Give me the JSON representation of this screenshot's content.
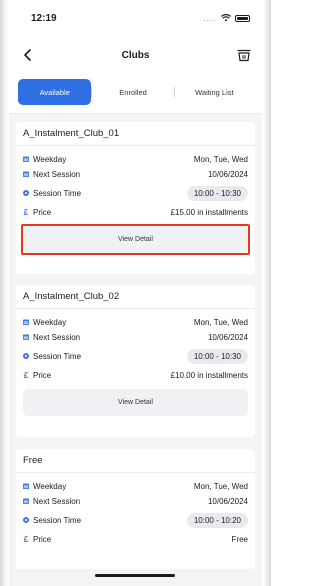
{
  "status_bar": {
    "time": "12:19",
    "signal_dots": "....",
    "wifi_icon": "wifi-icon",
    "battery_icon": "battery-icon"
  },
  "nav": {
    "title": "Clubs",
    "back_icon": "chevron-left-icon",
    "cart_icon": "basket-icon"
  },
  "tabs": [
    {
      "label": "Available",
      "active": true
    },
    {
      "label": "Enrolled",
      "active": false
    },
    {
      "label": "Waiting List",
      "active": false
    }
  ],
  "clubs": [
    {
      "name": "A_Instalment_Club_01",
      "weekday_label": "Weekday",
      "weekday_value": "Mon, Tue, Wed",
      "next_label": "Next Session",
      "next_value": "10/06/2024",
      "time_label": "Session Time",
      "time_value": "10:00 - 10:30",
      "price_label": "Price",
      "price_value": "£15.00 in installments",
      "button_label": "View Detail",
      "highlighted": true
    },
    {
      "name": "A_Instalment_Club_02",
      "weekday_label": "Weekday",
      "weekday_value": "Mon, Tue, Wed",
      "next_label": "Next Session",
      "next_value": "10/06/2024",
      "time_label": "Session Time",
      "time_value": "10:00 - 10:30",
      "price_label": "Price",
      "price_value": "£10.00 in installments",
      "button_label": "View Detail",
      "highlighted": false
    },
    {
      "name": "Free",
      "weekday_label": "Weekday",
      "weekday_value": "Mon, Tue, Wed",
      "next_label": "Next Session",
      "next_value": "10/06/2024",
      "time_label": "Session Time",
      "time_value": "10:00 - 10:20",
      "price_label": "Price",
      "price_value": "Free"
    }
  ],
  "icons": {
    "calendar": "calendar-icon",
    "clock": "clock-icon",
    "pound": "pound-icon"
  },
  "colors": {
    "accent": "#2f6fe4",
    "highlight": "#e23a1f",
    "background": "#f4f4f6"
  }
}
